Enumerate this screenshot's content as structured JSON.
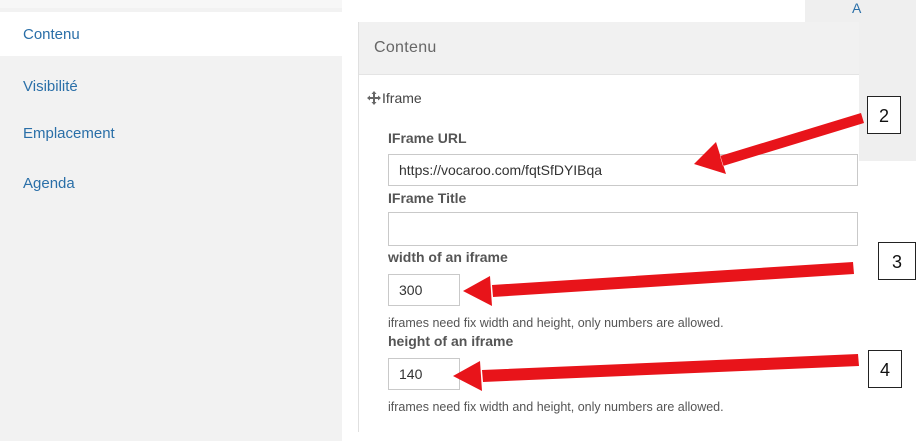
{
  "sidebar": {
    "items": [
      {
        "label": "Contenu",
        "active": true
      },
      {
        "label": "Visibilité",
        "active": false
      },
      {
        "label": "Emplacement",
        "active": false
      },
      {
        "label": "Agenda",
        "active": false
      }
    ]
  },
  "corner_letter": "A",
  "panel": {
    "title": "Contenu",
    "widget": {
      "icon": "move-icon",
      "title": "Iframe"
    },
    "fields": {
      "url": {
        "label": "IFrame URL",
        "value": "https://vocaroo.com/fqtSfDYIBqa"
      },
      "title": {
        "label": "IFrame Title",
        "value": ""
      },
      "width": {
        "label": "width of an iframe",
        "value": "300",
        "help": "iframes need fix width and height, only numbers are allowed."
      },
      "height": {
        "label": "height of an iframe",
        "value": "140",
        "help": "iframes need fix width and height, only numbers are allowed."
      }
    }
  },
  "annotations": {
    "numbers": [
      "2",
      "3",
      "4"
    ],
    "arrow_color": "#e8141a"
  },
  "colors": {
    "link": "#2a6fa8",
    "sidebar_bg": "#f2f2f2",
    "panel_header_bg": "#f1f1f1"
  }
}
